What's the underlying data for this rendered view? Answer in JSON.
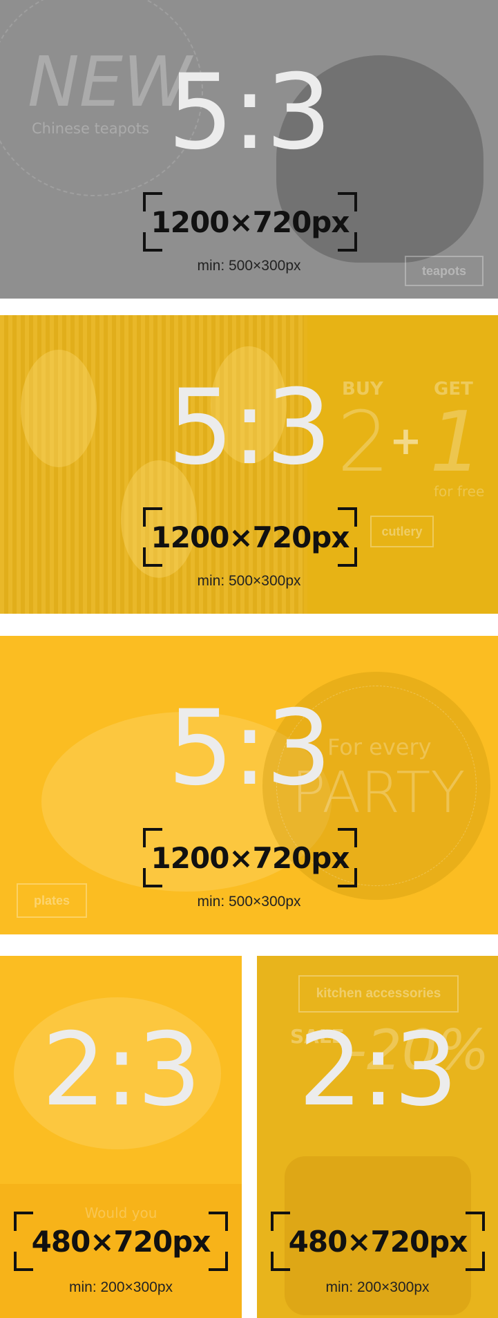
{
  "banners": [
    {
      "ratio": "5:3",
      "size": "1200×720px",
      "min": "min: 500×300px",
      "deco": {
        "headline": "NEW",
        "subline": "Chinese teapots",
        "button": "teapots"
      }
    },
    {
      "ratio": "5:3",
      "size": "1200×720px",
      "min": "min: 500×300px",
      "deco": {
        "buy": "BUY",
        "get": "GET",
        "two": "2",
        "plus": "+",
        "one": "1",
        "free": "for free",
        "button": "cutlery"
      }
    },
    {
      "ratio": "5:3",
      "size": "1200×720px",
      "min": "min: 500×300px",
      "deco": {
        "for_every": "For every",
        "party": "PARTY",
        "button": "plates"
      }
    },
    {
      "ratio": "2:3",
      "size": "480×720px",
      "min": "min: 200×300px",
      "deco": {
        "would": "Would you"
      }
    },
    {
      "ratio": "2:3",
      "size": "480×720px",
      "min": "min: 200×300px",
      "deco": {
        "button": "kitchen accessories",
        "sale": "SALE",
        "percent": "-20%"
      }
    }
  ],
  "colors": {
    "gray_banner": "#8f8f8f",
    "mustard_banner": "#e8b41c",
    "yellow_banner": "#fbbd22",
    "ratio_text": "#ececec",
    "frame": "#111111"
  }
}
